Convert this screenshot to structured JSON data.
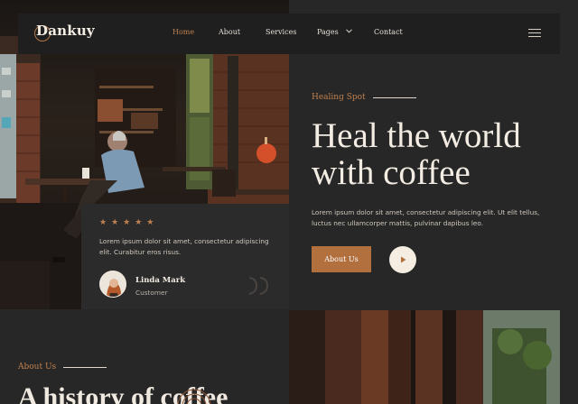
{
  "brand": {
    "name": "Dankuy"
  },
  "nav": {
    "items": [
      {
        "label": "Home",
        "active": true
      },
      {
        "label": "About"
      },
      {
        "label": "Services"
      },
      {
        "label": "Pages",
        "has_dropdown": true
      },
      {
        "label": "Contact"
      }
    ],
    "menu_icon": "hamburger-icon"
  },
  "hero": {
    "eyebrow": "Healing Spot",
    "title_line1": "Heal the world",
    "title_line2": "with coffee",
    "description": "Lorem ipsum dolor sit amet, consectetur adipiscing elit. Ut elit tellus, luctus nec ullamcorper mattis, pulvinar dapibus leo.",
    "cta_label": "About Us",
    "play_icon": "play-icon"
  },
  "testimonial": {
    "rating": 5,
    "stars": "★★★★★",
    "text": "Lorem ipsum dolor sit amet, consectetur adipiscing elit. Curabitur eros risus.",
    "name": "Linda Mark",
    "role": "Customer"
  },
  "about": {
    "eyebrow": "About Us",
    "title": "A history of coffee"
  },
  "colors": {
    "accent": "#b3703f",
    "accent_text": "#c0804f",
    "background": "#272727",
    "nav_bg": "#1f1f1f",
    "card_bg": "#2b2b2b"
  }
}
